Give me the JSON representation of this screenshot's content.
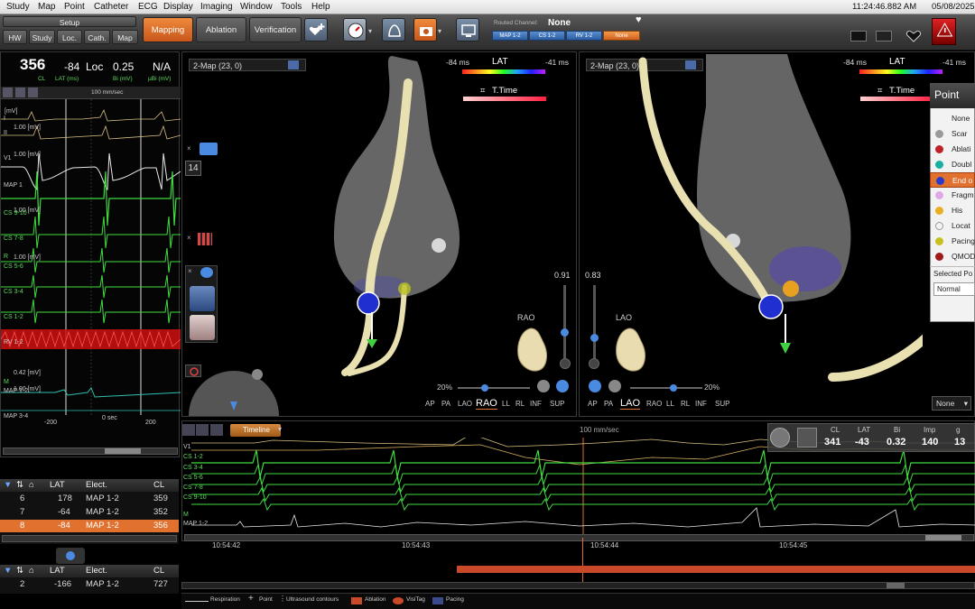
{
  "menu": [
    "Study",
    "Map",
    "Point",
    "Catheter",
    "ECG",
    "Display",
    "Imaging",
    "Window",
    "Tools",
    "Help"
  ],
  "clock": {
    "time": "11:24:46.882 AM",
    "date": "05/08/2025"
  },
  "toolbar": {
    "setup": "Setup",
    "sub": [
      "HW",
      "Study",
      "Loc.",
      "Cath.",
      "Map"
    ],
    "modes": [
      "Mapping",
      "Ablation",
      "Verification"
    ],
    "routed_label": "Routed Channel:",
    "routed_value": "None",
    "routed_chips": [
      "MAP 1-2",
      "CS 1-2",
      "RV 1-2",
      "None"
    ]
  },
  "readout": {
    "cl": "356",
    "lat": "-84",
    "loc": "Loc",
    "bi": "0.25",
    "ubi": "N/A",
    "cl_label": "CL",
    "lat_label": "LAT (ms)",
    "bi_label": "Bi (mV)",
    "ubi_label": "µBi (mV)"
  },
  "ecg_panel": {
    "speed": "100 mm/sec",
    "scales": [
      "[mV]",
      "1.00 [mV]",
      "1.00 [mV]",
      "1.00 [mV]",
      "1.00 [mV]",
      "0.42 [mV]",
      "1.00 [mV]"
    ],
    "channels": [
      "I",
      "II",
      "V1",
      "MAP 1",
      "CS 9-10",
      "CS 7-8",
      "R",
      "CS 5-6",
      "CS 3-4",
      "CS 1-2",
      "RV 1-2",
      "M",
      "MAP 1-2",
      "MAP 3-4"
    ],
    "bottom_ticks": [
      "-200",
      "0 sec",
      "200"
    ]
  },
  "points_table": {
    "headers": [
      "LAT",
      "Elect.",
      "CL"
    ],
    "rows": [
      {
        "n": "6",
        "lat": "178",
        "elect": "MAP 1-2",
        "cl": "359"
      },
      {
        "n": "7",
        "lat": "-64",
        "elect": "MAP 1-2",
        "cl": "352"
      },
      {
        "n": "8",
        "lat": "-84",
        "elect": "MAP 1-2",
        "cl": "356"
      }
    ]
  },
  "points_table2": {
    "headers": [
      "LAT",
      "Elect.",
      "CL"
    ],
    "rows": [
      {
        "n": "2",
        "lat": "-166",
        "elect": "MAP 1-2",
        "cl": "727"
      }
    ]
  },
  "map_left": {
    "label": "2-Map (23, 0)",
    "scale_min": "-84 ms",
    "scale_title": "LAT",
    "scale_max": "-41 ms",
    "ttime": "T.Time",
    "tool_num": "14",
    "opacity": "0.91",
    "orientation": "RAO",
    "zoom": "20%",
    "views": [
      "AP",
      "PA",
      "LAO",
      "RAO",
      "LL",
      "RL",
      "INF",
      "SUP"
    ],
    "active_view": "RAO"
  },
  "map_right": {
    "label": "2-Map (23, 0)",
    "scale_min": "-84 ms",
    "scale_title": "LAT",
    "scale_max": "-41 ms",
    "ttime": "T.Time",
    "opacity": "0.83",
    "orientation": "LAO",
    "zoom": "20%",
    "views": [
      "AP",
      "PA",
      "LAO",
      "RAO",
      "LL",
      "RL",
      "INF",
      "SUP"
    ],
    "active_view": "LAO",
    "dropdown": "None"
  },
  "point_type": {
    "title": "Point",
    "items": [
      {
        "label": "None",
        "color": "transparent"
      },
      {
        "label": "Scar",
        "color": "#9a9a9a"
      },
      {
        "label": "Ablati",
        "color": "#c0202a"
      },
      {
        "label": "Doubl",
        "color": "#1ab0a0"
      },
      {
        "label": "End o",
        "color": "#2a3ac8"
      },
      {
        "label": "Fragm",
        "color": "#e0a8e8"
      },
      {
        "label": "His",
        "color": "#e8b020"
      },
      {
        "label": "Locat",
        "color": "#f4f4f4"
      },
      {
        "label": "Pacing",
        "color": "#c8c020"
      },
      {
        "label": "QMOD",
        "color": "#a01818"
      }
    ],
    "selected_index": 4,
    "selected_label": "Selected Po",
    "selected_value": "Normal"
  },
  "timeline": {
    "button": "Timeline",
    "speed": "100 mm/sec",
    "channels": [
      "V1",
      "CS 1-2",
      "CS 3-4",
      "CS 5-6",
      "CS 7-8",
      "CS 9-10",
      "M",
      "MAP 1-2"
    ],
    "times": [
      "10:54:42",
      "10:54:43",
      "10:54:44",
      "10:54:45"
    ],
    "readout_labels": [
      "CL",
      "LAT",
      "Bi",
      "Imp",
      "g"
    ],
    "readout_values": [
      "341",
      "-43",
      "0.32",
      "140",
      "13"
    ]
  },
  "legend": [
    "Respiration",
    "Point",
    "Ultrasound contours",
    "Ablation",
    "VisiTag",
    "Pacing"
  ]
}
